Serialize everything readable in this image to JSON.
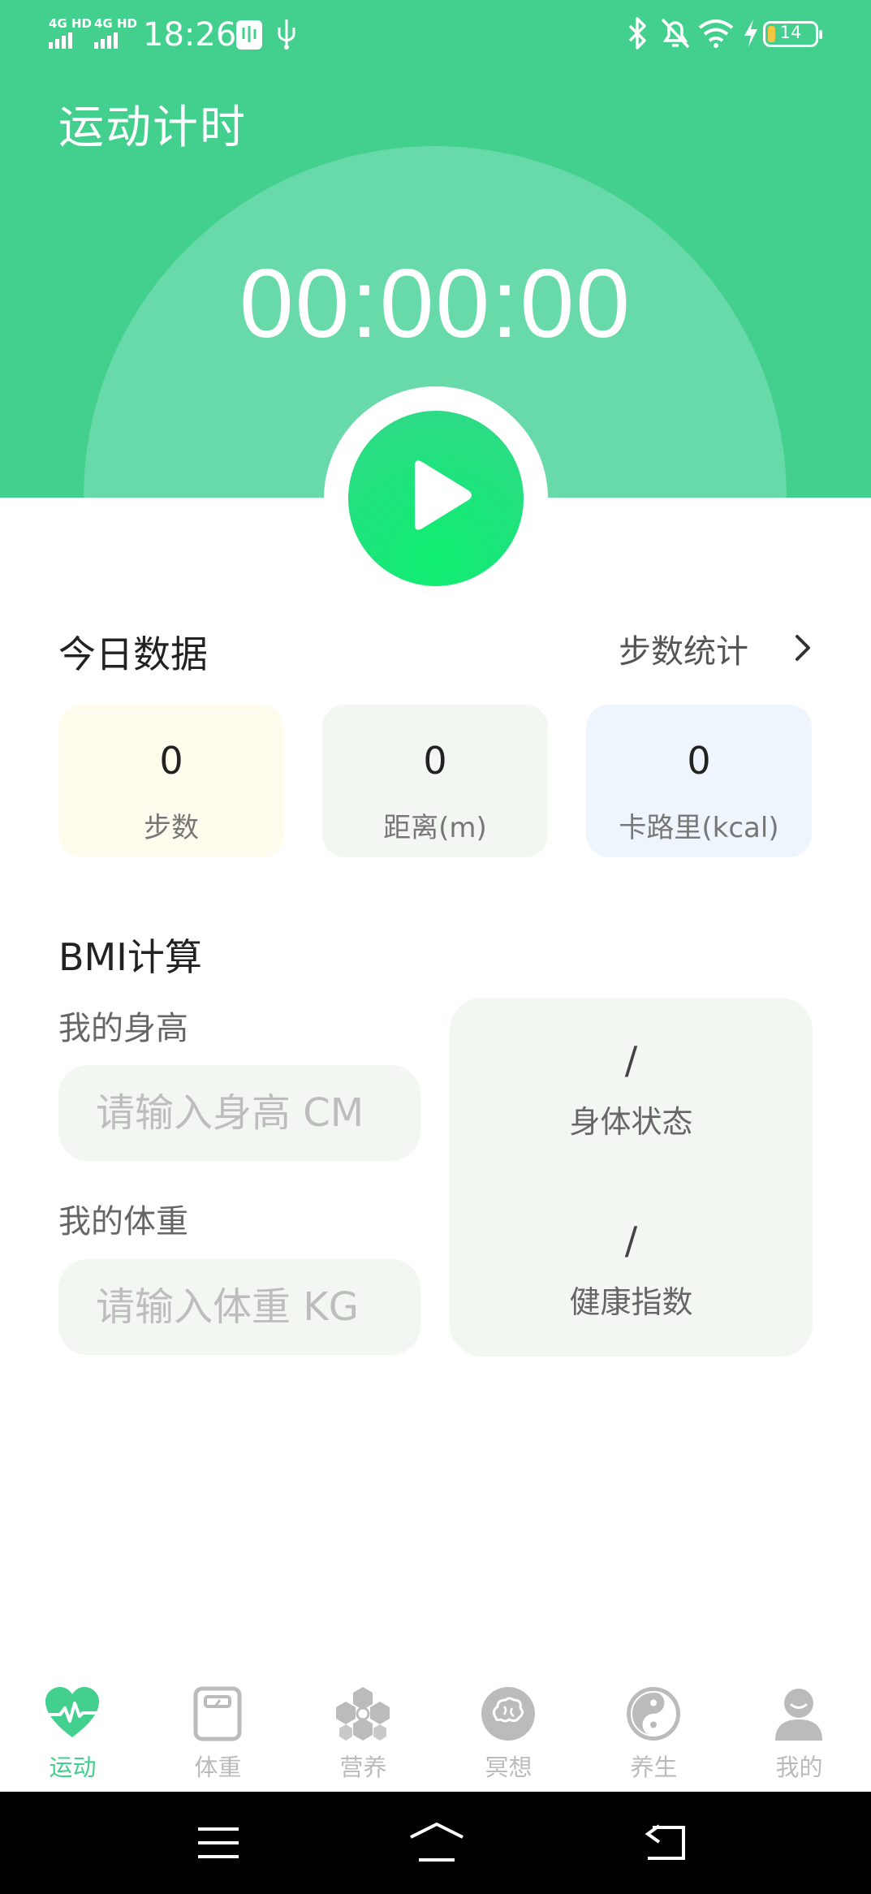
{
  "status_bar": {
    "signal1": "4G HD",
    "signal2": "4G HD",
    "time": "18:26",
    "battery": "14"
  },
  "header": {
    "title": "运动计时",
    "timer": "00:00:00"
  },
  "today": {
    "title": "今日数据",
    "link": "步数统计",
    "cards": [
      {
        "value": "0",
        "label": "步数",
        "bg": "#FFFCEE"
      },
      {
        "value": "0",
        "label": "距离(m)",
        "bg": "#F3F7F2"
      },
      {
        "value": "0",
        "label": "卡路里(kcal)",
        "bg": "#EFF5FD"
      }
    ]
  },
  "bmi": {
    "title": "BMI计算",
    "height_label": "我的身高",
    "height_placeholder": "请输入身高 CM",
    "weight_label": "我的体重",
    "weight_placeholder": "请输入体重 KG",
    "body_state_value": "/",
    "body_state_label": "身体状态",
    "health_index_value": "/",
    "health_index_label": "健康指数"
  },
  "nav": {
    "active_color": "#43CF8E",
    "inactive_color": "#BBBBBB",
    "items": [
      {
        "label": "运动",
        "icon": "heart-pulse-icon"
      },
      {
        "label": "体重",
        "icon": "scale-icon"
      },
      {
        "label": "营养",
        "icon": "hexagon-cluster-icon"
      },
      {
        "label": "冥想",
        "icon": "brain-icon"
      },
      {
        "label": "养生",
        "icon": "yin-yang-icon"
      },
      {
        "label": "我的",
        "icon": "user-icon"
      }
    ]
  },
  "colors": {
    "primary": "#43CF8E",
    "play": "#1BE57A"
  }
}
